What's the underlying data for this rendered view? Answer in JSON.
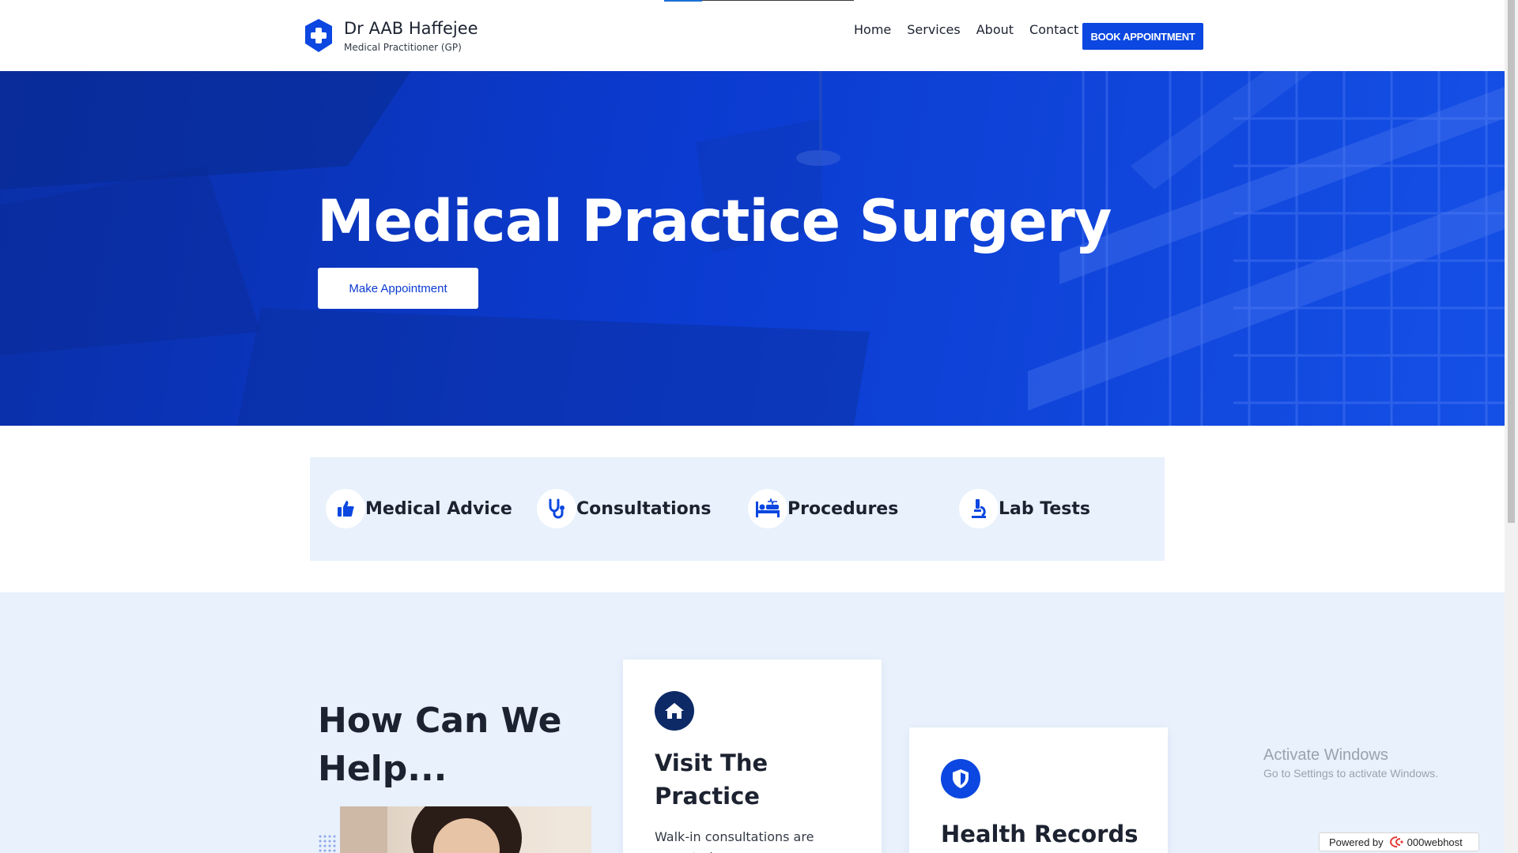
{
  "header": {
    "brand_title": "Dr AAB Haffejee",
    "brand_subtitle": "Medical Practitioner (GP)",
    "logo_icon": "medical-cross-shield-icon",
    "nav": [
      {
        "label": "Home"
      },
      {
        "label": "Services"
      },
      {
        "label": "About"
      },
      {
        "label": "Contact"
      }
    ],
    "cta_label": "BOOK APPOINTMENT"
  },
  "hero": {
    "title": "Medical Practice Surgery",
    "button_label": "Make Appointment"
  },
  "features": [
    {
      "label": "Medical Advice",
      "icon": "thumbs-up-icon"
    },
    {
      "label": "Consultations",
      "icon": "stethoscope-icon"
    },
    {
      "label": "Procedures",
      "icon": "hospital-bed-icon"
    },
    {
      "label": "Lab Tests",
      "icon": "microscope-icon"
    }
  ],
  "help": {
    "title": "How Can We Help...",
    "cards": [
      {
        "title": "Visit The Practice",
        "text": "Walk-in consultations are accepted...",
        "icon": "home-icon"
      },
      {
        "title": "Health Records",
        "icon": "shield-icon"
      }
    ]
  },
  "overlay": {
    "activate_title": "Activate Windows",
    "activate_sub": "Go to Settings to activate Windows.",
    "powered_by": "Powered by",
    "powered_brand": "000webhost"
  },
  "colors": {
    "accent": "#0b47e0",
    "hero_blue": "#0b3bd0",
    "section_bg": "#e8f1fc",
    "dark_icon": "#0d2a66"
  }
}
